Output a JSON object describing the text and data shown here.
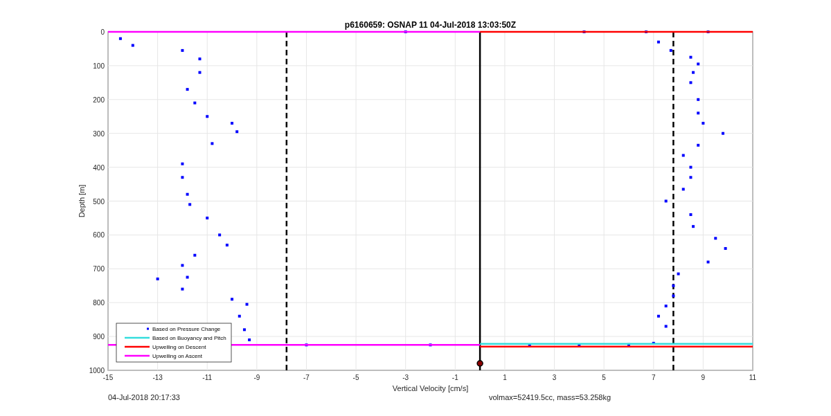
{
  "figure": {
    "title": "p6160659: OSNAP 11 04-Jul-2018 13:03:50Z",
    "chart_data": {
      "type": "scatter",
      "xlabel": "Vertical Velocity [cm/s]",
      "ylabel": "Depth [m]",
      "xlim": [
        -15,
        11
      ],
      "ylim": [
        1000,
        0
      ],
      "xticks": [
        -15,
        -13,
        -11,
        -9,
        -7,
        -5,
        -3,
        -1,
        1,
        3,
        5,
        7,
        9,
        11
      ],
      "yticks": [
        0,
        100,
        200,
        300,
        400,
        500,
        600,
        700,
        800,
        900,
        1000
      ],
      "series": [
        {
          "name": "Based on Pressure Change",
          "color": "#0000ff",
          "x": [
            -14.5,
            -14,
            -12,
            -11.3,
            -11.3,
            -11.8,
            -11.5,
            -11,
            -10,
            -9.8,
            -10.8,
            -12,
            -12,
            -11.8,
            -11.7,
            -11,
            -10.5,
            -10.2,
            -11.5,
            -12,
            -11.8,
            -13,
            -12,
            -10,
            -9.4,
            -9.7,
            -9.5,
            -9.3,
            -7,
            -2,
            2,
            4,
            6,
            -3,
            4.2,
            9.2,
            6.7,
            7.2,
            7.7,
            8.5,
            8.8,
            8.6,
            8.5,
            8.8,
            8.8,
            9,
            9.8,
            8.8,
            8.2,
            8.5,
            8.5,
            8.2,
            7.5,
            8.5,
            8.6,
            9.5,
            9.9,
            9.2,
            8,
            7.8,
            7.8,
            7.5,
            7.2,
            7.5,
            7
          ],
          "values": [
            20,
            40,
            55,
            80,
            120,
            170,
            210,
            250,
            270,
            295,
            330,
            390,
            430,
            480,
            510,
            550,
            600,
            630,
            660,
            690,
            725,
            730,
            760,
            790,
            805,
            840,
            880,
            910,
            925,
            925,
            928,
            926,
            924,
            0,
            0,
            0,
            0,
            30,
            55,
            75,
            95,
            120,
            150,
            200,
            240,
            270,
            300,
            335,
            365,
            400,
            430,
            465,
            500,
            540,
            575,
            610,
            640,
            680,
            715,
            750,
            780,
            810,
            840,
            870,
            920
          ]
        },
        {
          "name": "Based on Buoyancy and Pitch",
          "type": "line",
          "color": "#33dddd",
          "x": [
            0,
            11
          ],
          "values": [
            922,
            922
          ]
        },
        {
          "name": "Upwelling on Descent",
          "type": "line",
          "color": "#ff0000",
          "x": [
            0,
            11
          ],
          "values": [
            0,
            0
          ]
        },
        {
          "name": "Upwelling on Ascent",
          "type": "line",
          "color": "#ff00ff",
          "x": [
            -15,
            0
          ],
          "values": [
            0,
            0
          ]
        },
        {
          "type": "line",
          "color": "#ff0000",
          "x": [
            0,
            11
          ],
          "values": [
            930,
            930
          ]
        },
        {
          "type": "line",
          "color": "#ff00ff",
          "x": [
            -15,
            0
          ],
          "values": [
            925,
            925
          ]
        }
      ],
      "grid": true,
      "legend": true,
      "ref_lines": [
        {
          "axis": "x",
          "value": -7.8
        },
        {
          "axis": "x",
          "value": 7.8
        },
        {
          "axis": "x",
          "value": 0
        }
      ]
    }
  },
  "footer": {
    "timestamp": "04-Jul-2018 20:17:33",
    "summary": "volmax=52419.5cc, mass=53.258kg"
  }
}
